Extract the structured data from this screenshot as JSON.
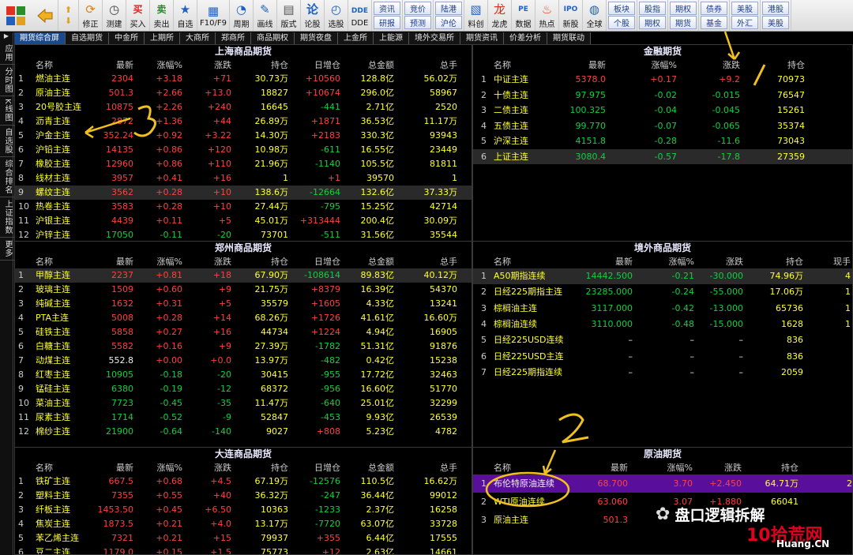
{
  "toolbar": {
    "buy": "买入",
    "sell": "卖出",
    "buy_icon": "买",
    "sell_icon": "卖",
    "items": [
      "修正",
      "测建",
      "自选",
      "F10/F9",
      "周期",
      "画线",
      "版式",
      "论股",
      "选股",
      "DDE",
      "料创",
      "龙虎",
      "数据",
      "热点",
      "新股",
      "全球"
    ],
    "mid_buttons": [
      [
        "资讯",
        "研报"
      ],
      [
        "竞价",
        "预测"
      ],
      [
        "陆港",
        "沪伦"
      ]
    ],
    "right_buttons": [
      [
        "板块",
        "个股"
      ],
      [
        "股指",
        "期权"
      ],
      [
        "期权",
        "期货"
      ],
      [
        "债券",
        "基金"
      ],
      [
        "美股",
        "外汇"
      ],
      [
        "港股",
        "美股"
      ]
    ]
  },
  "tabs": [
    "期货综合屏",
    "自选期货",
    "中金所",
    "上期所",
    "大商所",
    "郑商所",
    "商品期权",
    "期货夜盘",
    "上金所",
    "上能源",
    "境外交易所",
    "期货资讯",
    "价差分析",
    "期货联动"
  ],
  "sidebar": [
    "应用",
    "分时图",
    "K线图",
    "自选股",
    "综合排名",
    "上证指数",
    "更多"
  ],
  "shanghai": {
    "title": "上海商品期货",
    "headers": [
      "名称",
      "最新",
      "涨幅%",
      "涨跌",
      "持仓",
      "日增仓",
      "总金额",
      "总手"
    ],
    "rows": [
      [
        "1",
        "燃油主连",
        "2304",
        "+3.18",
        "+71",
        "30.73万",
        "+10560",
        "128.8亿",
        "56.02万"
      ],
      [
        "2",
        "原油主连",
        "501.3",
        "+2.66",
        "+13.0",
        "18827",
        "+10674",
        "296.0亿",
        "58967"
      ],
      [
        "3",
        "20号胶主连",
        "10875",
        "+2.26",
        "+240",
        "16645",
        "-441",
        "2.71亿",
        "2520"
      ],
      [
        "4",
        "沥青主连",
        "2872",
        "+1.36",
        "+44",
        "26.89万",
        "+1871",
        "36.53亿",
        "11.17万"
      ],
      [
        "5",
        "沪金主连",
        "352.24",
        "+0.92",
        "+3.22",
        "14.30万",
        "+2183",
        "330.3亿",
        "93943"
      ],
      [
        "6",
        "沪铅主连",
        "14135",
        "+0.86",
        "+120",
        "10.98万",
        "-611",
        "16.55亿",
        "23449"
      ],
      [
        "7",
        "橡胶主连",
        "12960",
        "+0.86",
        "+110",
        "21.96万",
        "-1140",
        "105.5亿",
        "81811"
      ],
      [
        "8",
        "线材主连",
        "3957",
        "+0.41",
        "+16",
        "1",
        "+1",
        "39570",
        "1"
      ],
      [
        "9",
        "螺纹主连",
        "3562",
        "+0.28",
        "+10",
        "138.6万",
        "-12664",
        "132.6亿",
        "37.33万"
      ],
      [
        "10",
        "热卷主连",
        "3583",
        "+0.28",
        "+10",
        "27.44万",
        "-795",
        "15.25亿",
        "42714"
      ],
      [
        "11",
        "沪银主连",
        "4439",
        "+0.11",
        "+5",
        "45.01万",
        "+313444",
        "200.4亿",
        "30.09万"
      ],
      [
        "12",
        "沪锌主连",
        "17050",
        "-0.11",
        "-20",
        "73701",
        "-511",
        "31.56亿",
        "35544"
      ]
    ]
  },
  "zhengzhou": {
    "title": "郑州商品期货",
    "headers": [
      "名称",
      "最新",
      "涨幅%",
      "涨跌",
      "持仓",
      "日增仓",
      "总金额",
      "总手"
    ],
    "rows": [
      [
        "1",
        "甲醇主连",
        "2237",
        "+0.81",
        "+18",
        "67.90万",
        "-108614",
        "89.83亿",
        "40.12万"
      ],
      [
        "2",
        "玻璃主连",
        "1509",
        "+0.60",
        "+9",
        "21.75万",
        "+8379",
        "16.39亿",
        "54370"
      ],
      [
        "3",
        "纯碱主连",
        "1632",
        "+0.31",
        "+5",
        "35579",
        "+1605",
        "4.33亿",
        "13241"
      ],
      [
        "4",
        "PTA主连",
        "5008",
        "+0.28",
        "+14",
        "68.26万",
        "+1726",
        "41.61亿",
        "16.60万"
      ],
      [
        "5",
        "硅铁主连",
        "5858",
        "+0.27",
        "+16",
        "44734",
        "+1224",
        "4.94亿",
        "16905"
      ],
      [
        "6",
        "白糖主连",
        "5582",
        "+0.16",
        "+9",
        "27.39万",
        "-1782",
        "51.31亿",
        "91876"
      ],
      [
        "7",
        "动煤主连",
        "552.8",
        "+0.00",
        "+0.0",
        "13.97万",
        "-482",
        "0.42亿",
        "15238"
      ],
      [
        "8",
        "红枣主连",
        "10905",
        "-0.18",
        "-20",
        "30415",
        "-955",
        "17.72亿",
        "32463"
      ],
      [
        "9",
        "锰硅主连",
        "6380",
        "-0.19",
        "-12",
        "68372",
        "-956",
        "16.60亿",
        "51770"
      ],
      [
        "10",
        "菜油主连",
        "7723",
        "-0.45",
        "-35",
        "11.47万",
        "-640",
        "25.01亿",
        "32299"
      ],
      [
        "11",
        "尿素主连",
        "1714",
        "-0.52",
        "-9",
        "52847",
        "-453",
        "9.93亿",
        "26539"
      ],
      [
        "12",
        "棉纱主连",
        "21900",
        "-0.64",
        "-140",
        "9027",
        "+808",
        "5.23亿",
        "4782"
      ]
    ]
  },
  "dalian": {
    "title": "大连商品期货",
    "headers": [
      "名称",
      "最新",
      "涨幅%",
      "涨跌",
      "持仓",
      "日增仓",
      "总金额",
      "总手"
    ],
    "rows": [
      [
        "1",
        "铁矿主连",
        "667.5",
        "+0.68",
        "+4.5",
        "67.19万",
        "-12576",
        "110.5亿",
        "16.62万"
      ],
      [
        "2",
        "塑料主连",
        "7355",
        "+0.55",
        "+40",
        "36.32万",
        "-247",
        "36.44亿",
        "99012"
      ],
      [
        "3",
        "纤板主连",
        "1453.50",
        "+0.45",
        "+6.50",
        "10363",
        "-1233",
        "2.37亿",
        "16258"
      ],
      [
        "4",
        "焦炭主连",
        "1873.5",
        "+0.21",
        "+4.0",
        "13.17万",
        "-7720",
        "63.07亿",
        "33728"
      ],
      [
        "5",
        "苯乙烯主连",
        "7321",
        "+0.21",
        "+15",
        "79937",
        "+355",
        "6.44亿",
        "17555"
      ],
      [
        "6",
        "豆二主连",
        "1179.0",
        "+0.15",
        "+1.5",
        "75773",
        "+12",
        "2.63亿",
        "14661"
      ]
    ]
  },
  "finance": {
    "title": "金融期货",
    "headers": [
      "名称",
      "最新",
      "涨幅%",
      "涨跌",
      "持仓"
    ],
    "rows": [
      [
        "1",
        "中证主连",
        "5378.0",
        "+0.17",
        "+9.2",
        "70973"
      ],
      [
        "2",
        "十债主连",
        "97.975",
        "-0.02",
        "-0.015",
        "76547"
      ],
      [
        "3",
        "二债主连",
        "100.325",
        "-0.04",
        "-0.045",
        "15261"
      ],
      [
        "4",
        "五债主连",
        "99.770",
        "-0.07",
        "-0.065",
        "35374"
      ],
      [
        "5",
        "沪深主连",
        "4151.8",
        "-0.28",
        "-11.6",
        "73043"
      ],
      [
        "6",
        "上证主连",
        "3080.4",
        "-0.57",
        "-17.8",
        "27359"
      ]
    ]
  },
  "overseas": {
    "title": "境外商品期货",
    "headers": [
      "名称",
      "最新",
      "涨幅%",
      "涨跌",
      "持仓",
      "现手"
    ],
    "rows": [
      [
        "1",
        "A50期指连续",
        "14442.500",
        "-0.21",
        "-30.000",
        "74.96万",
        "4"
      ],
      [
        "2",
        "日经225期指主连",
        "23285.000",
        "-0.24",
        "-55.000",
        "17.06万",
        "1"
      ],
      [
        "3",
        "棕榈油主连",
        "3117.000",
        "-0.42",
        "-13.000",
        "65736",
        "1"
      ],
      [
        "4",
        "棕榈油连续",
        "3110.000",
        "-0.48",
        "-15.000",
        "1628",
        "1"
      ],
      [
        "5",
        "日经225USD连续",
        "–",
        "–",
        "–",
        "836",
        ""
      ],
      [
        "6",
        "日经225USD主连",
        "–",
        "–",
        "–",
        "836",
        ""
      ],
      [
        "7",
        "日经225期指连续",
        "–",
        "–",
        "–",
        "2059",
        ""
      ]
    ]
  },
  "crude": {
    "title": "原油期货",
    "headers": [
      "名称",
      "最新",
      "涨幅%",
      "涨跌",
      "持仓"
    ],
    "rows": [
      [
        "1",
        "布伦特原油连续",
        "68.700",
        "3.70",
        "+2.450",
        "64.71万",
        "2"
      ],
      [
        "2",
        "WTI原油连续",
        "63.060",
        "3.07",
        "+1.880",
        "66041",
        ""
      ],
      [
        "3",
        "原油主连",
        "501.3",
        "",
        "",
        "",
        ""
      ]
    ]
  },
  "annotations": {
    "a1": "1",
    "a2": "2",
    "a3": "3"
  },
  "watermark": {
    "text": "盘口逻辑拆解",
    "brand": "10拾荒网",
    "domain": "Huang.CN"
  }
}
